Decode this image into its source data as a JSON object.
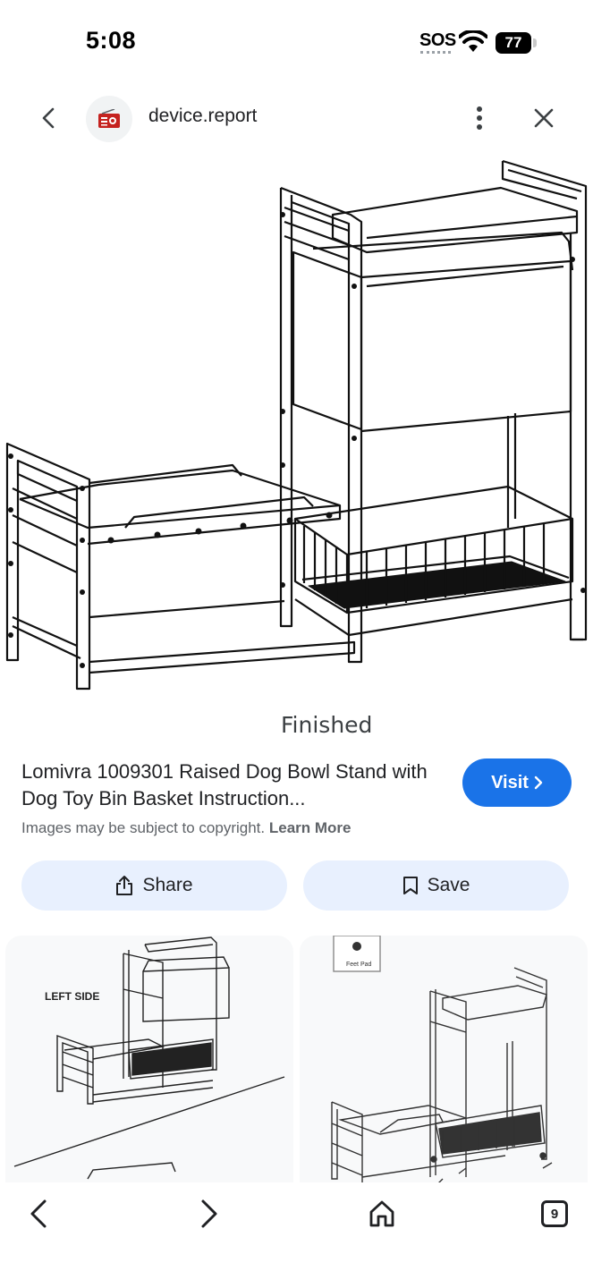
{
  "status_bar": {
    "time": "5:08",
    "sos": "SOS",
    "battery": "77"
  },
  "header": {
    "site_name": "device.report",
    "site_icon": "radio-icon"
  },
  "main_image": {
    "caption": "Finished",
    "description_icon": "furniture-line-drawing"
  },
  "result": {
    "title": "Lomivra 1009301 Raised Dog Bowl Stand with Dog Toy Bin Basket Instruction...",
    "visit_label": "Visit",
    "copyright_text": "Images may be subject to copyright.",
    "learn_more": "Learn More"
  },
  "actions": {
    "share_label": "Share",
    "save_label": "Save"
  },
  "related": {
    "left_label": "LEFT SIDE",
    "right_label": "Feet Pad"
  },
  "bottom_nav": {
    "tabs_count": "9"
  },
  "colors": {
    "accent": "#1a73e8",
    "chip_bg": "#e8f0fe",
    "text": "#202124",
    "muted": "#5f6368"
  }
}
